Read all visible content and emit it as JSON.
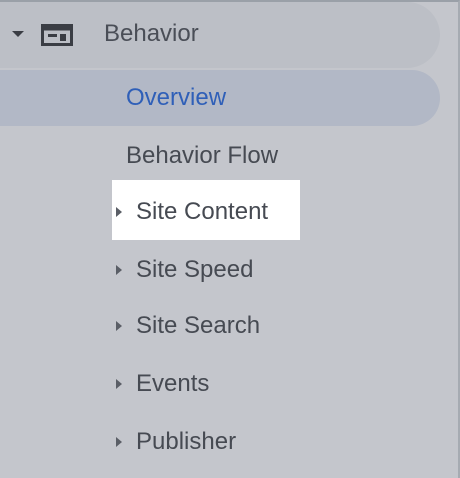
{
  "nav": {
    "section": {
      "label": "Behavior",
      "icon": "window-icon",
      "expanded": true
    },
    "items": [
      {
        "label": "Overview",
        "active": true
      },
      {
        "label": "Behavior Flow"
      },
      {
        "label": "Site Content",
        "expandable": true,
        "highlighted": true
      },
      {
        "label": "Site Speed",
        "expandable": true
      },
      {
        "label": "Site Search",
        "expandable": true
      },
      {
        "label": "Events",
        "expandable": true
      },
      {
        "label": "Publisher",
        "expandable": true
      }
    ]
  },
  "colors": {
    "background": "#c4c6cc",
    "active_text": "#2f5fb8",
    "active_bg": "#b2b8c6",
    "highlight_bg": "#ffffff",
    "text": "#464a52"
  }
}
